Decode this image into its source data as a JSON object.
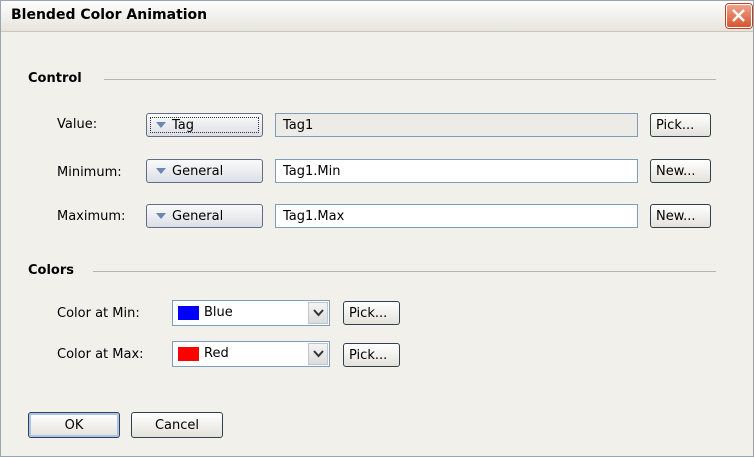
{
  "window": {
    "title": "Blended Color Animation"
  },
  "control": {
    "heading": "Control",
    "rows": [
      {
        "label": "Value:",
        "type": "Tag",
        "field": "Tag1",
        "action": "Pick..."
      },
      {
        "label": "Minimum:",
        "type": "General",
        "field": "Tag1.Min",
        "action": "New..."
      },
      {
        "label": "Maximum:",
        "type": "General",
        "field": "Tag1.Max",
        "action": "New..."
      }
    ]
  },
  "colors": {
    "heading": "Colors",
    "rows": [
      {
        "label": "Color at Min:",
        "value": "Blue",
        "swatch": "#0000ff",
        "action": "Pick..."
      },
      {
        "label": "Color at Max:",
        "value": "Red",
        "swatch": "#ff0000",
        "action": "Pick..."
      }
    ]
  },
  "buttons": {
    "ok": "OK",
    "cancel": "Cancel"
  },
  "icons": {
    "close": "close-icon",
    "dropdown": "triangle-down-icon",
    "combo_arrow": "chevron-down-icon"
  }
}
